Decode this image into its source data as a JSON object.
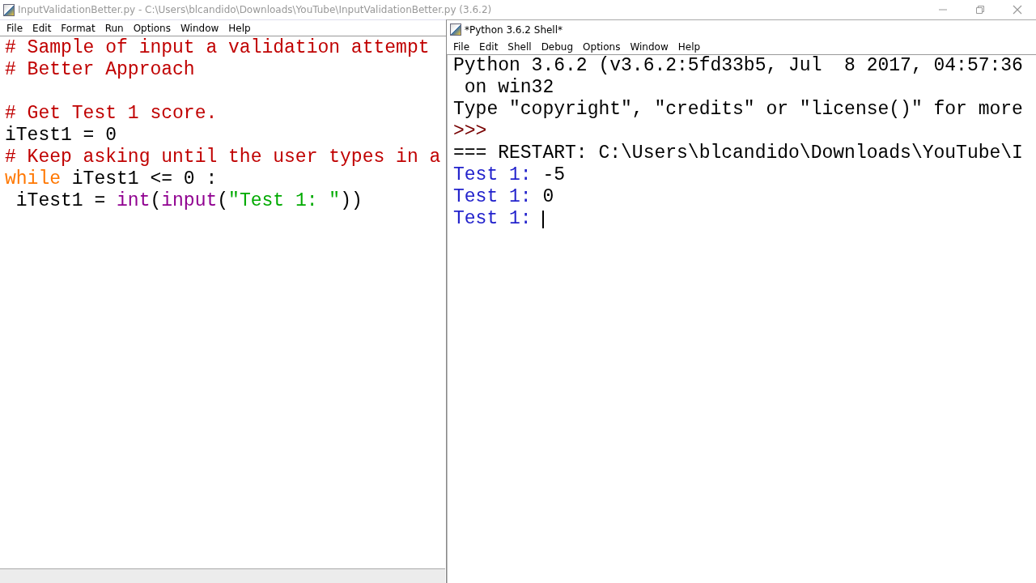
{
  "editor_window": {
    "title": "InputValidationBetter.py - C:\\Users\\blcandido\\Downloads\\YouTube\\InputValidationBetter.py (3.6.2)",
    "menu": [
      "File",
      "Edit",
      "Format",
      "Run",
      "Options",
      "Window",
      "Help"
    ],
    "code_lines": [
      [
        {
          "kind": "comment",
          "text": "# Sample of input a validation attempt"
        }
      ],
      [
        {
          "kind": "comment",
          "text": "# Better Approach"
        }
      ],
      [
        {
          "kind": "blank"
        },
        {
          "kind": "comment",
          "text": "# Get Test 1 score."
        }
      ],
      [
        {
          "kind": "plain",
          "text": "iTest1 = 0"
        }
      ],
      [
        {
          "kind": "comment",
          "text": "# Keep asking until the user types in a"
        }
      ],
      [
        {
          "kind": "keyword",
          "text": "while"
        },
        {
          "kind": "plain",
          "text": " iTest1 <= 0 :"
        }
      ],
      [
        {
          "kind": "plain",
          "text": " iTest1 = "
        },
        {
          "kind": "builtin",
          "text": "int"
        },
        {
          "kind": "plain",
          "text": "("
        },
        {
          "kind": "builtin",
          "text": "input"
        },
        {
          "kind": "plain",
          "text": "("
        },
        {
          "kind": "string",
          "text": "\"Test 1: \""
        },
        {
          "kind": "plain",
          "text": "))"
        }
      ]
    ]
  },
  "shell_window": {
    "title": "*Python 3.6.2 Shell*",
    "menu": [
      "File",
      "Edit",
      "Shell",
      "Debug",
      "Options",
      "Window",
      "Help"
    ],
    "lines": [
      [
        {
          "kind": "plain",
          "text": "Python 3.6.2 (v3.6.2:5fd33b5, Jul  8 2017, 04:57:36"
        }
      ],
      [
        {
          "kind": "plain",
          "text": " on win32"
        }
      ],
      [
        {
          "kind": "plain",
          "text": "Type \"copyright\", \"credits\" or \"license()\" for more"
        }
      ],
      [
        {
          "kind": "prompt",
          "text": ">>>"
        }
      ],
      [
        {
          "kind": "plain",
          "text": "=== RESTART: C:\\Users\\blcandido\\Downloads\\YouTube\\I"
        }
      ],
      [
        {
          "kind": "stdout",
          "text": "Test 1: "
        },
        {
          "kind": "plain",
          "text": "-5"
        }
      ],
      [
        {
          "kind": "stdout",
          "text": "Test 1: "
        },
        {
          "kind": "plain",
          "text": "0"
        }
      ],
      [
        {
          "kind": "stdout",
          "text": "Test 1: "
        },
        {
          "kind": "cursor"
        }
      ]
    ]
  }
}
